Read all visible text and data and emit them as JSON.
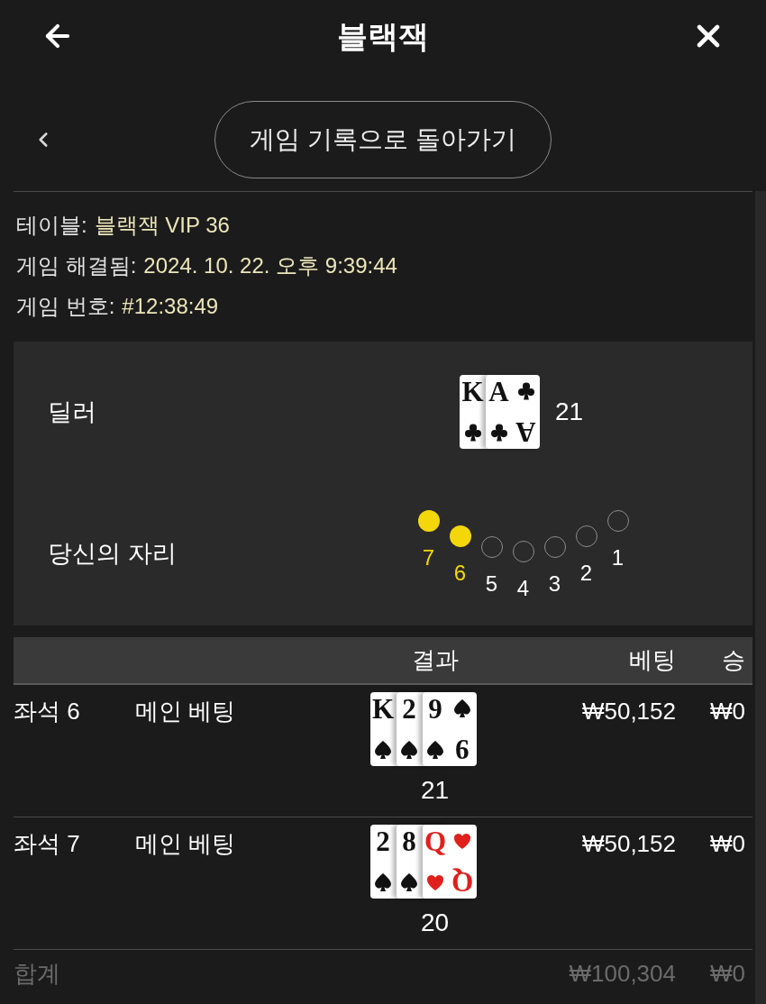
{
  "header": {
    "title": "블랙잭"
  },
  "back_button": {
    "label": "게임 기록으로 돌아가기"
  },
  "details": [
    {
      "label": "테이블:",
      "value": "블랙잭 VIP 36"
    },
    {
      "label": "게임 해결됨:",
      "value": "2024. 10. 22. 오후 9:39:44"
    },
    {
      "label": "게임 번호:",
      "value": "#12:38:49"
    }
  ],
  "dealer": {
    "label": "딜러",
    "cards": [
      {
        "rank": "K",
        "kind": "clubs"
      },
      {
        "rank": "A",
        "kind": "clubs",
        "corner_rank": "A"
      }
    ],
    "total": "21"
  },
  "seats": {
    "label": "당신의 자리",
    "items": [
      {
        "number": "7",
        "selected": true
      },
      {
        "number": "6",
        "selected": true
      },
      {
        "number": "5",
        "selected": false
      },
      {
        "number": "4",
        "selected": false
      },
      {
        "number": "3",
        "selected": false
      },
      {
        "number": "2",
        "selected": false
      },
      {
        "number": "1",
        "selected": false
      }
    ]
  },
  "table": {
    "columns": [
      "결과",
      "베팅",
      "승"
    ],
    "rows": [
      {
        "seat": "좌석 6",
        "bet_type": "메인 베팅",
        "cards": [
          {
            "rank": "K",
            "kind": "spades"
          },
          {
            "rank": "2",
            "kind": "spades"
          },
          {
            "rank": "9",
            "kind": "spades",
            "corner_rank": "9"
          }
        ],
        "total": "21",
        "bet": "₩50,152",
        "win": "₩0"
      },
      {
        "seat": "좌석 7",
        "bet_type": "메인 베팅",
        "cards": [
          {
            "rank": "2",
            "kind": "spades"
          },
          {
            "rank": "8",
            "kind": "spades"
          },
          {
            "rank": "Q",
            "kind": "hearts",
            "corner_rank": "Q"
          }
        ],
        "total": "20",
        "bet": "₩50,152",
        "win": "₩0"
      }
    ],
    "total_row": {
      "label": "합계",
      "bet": "₩100,304",
      "win": "₩0"
    }
  }
}
